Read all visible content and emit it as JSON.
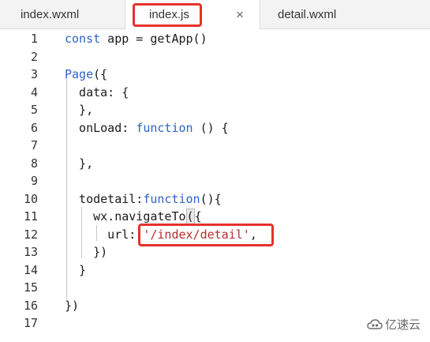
{
  "tabs": [
    {
      "label": "index.wxml"
    },
    {
      "label": "index.js",
      "close": "×"
    },
    {
      "label": "detail.wxml"
    }
  ],
  "lines": [
    {
      "n": "1",
      "code": [
        {
          "t": "kw",
          "v": "const"
        },
        {
          "t": "p",
          "v": " app = getApp()"
        }
      ]
    },
    {
      "n": "2",
      "code": []
    },
    {
      "n": "3",
      "code": [
        {
          "t": "kw",
          "v": "Page"
        },
        {
          "t": "p",
          "v": "({"
        }
      ]
    },
    {
      "n": "4",
      "code": [
        {
          "t": "p",
          "v": "  data: {"
        }
      ]
    },
    {
      "n": "5",
      "code": [
        {
          "t": "p",
          "v": "  },"
        }
      ]
    },
    {
      "n": "6",
      "code": [
        {
          "t": "p",
          "v": "  onLoad: "
        },
        {
          "t": "kw",
          "v": "function"
        },
        {
          "t": "p",
          "v": " () {"
        }
      ]
    },
    {
      "n": "7",
      "code": []
    },
    {
      "n": "8",
      "code": [
        {
          "t": "p",
          "v": "  },"
        }
      ]
    },
    {
      "n": "9",
      "code": []
    },
    {
      "n": "10",
      "code": [
        {
          "t": "p",
          "v": "  todetail:"
        },
        {
          "t": "kw",
          "v": "function"
        },
        {
          "t": "p",
          "v": "(){"
        }
      ]
    },
    {
      "n": "11",
      "code": [
        {
          "t": "p",
          "v": "    wx.navigateTo"
        },
        {
          "t": "brk",
          "v": "("
        },
        {
          "t": "p",
          "v": "{"
        }
      ]
    },
    {
      "n": "12",
      "code": [
        {
          "t": "p",
          "v": "      url: "
        },
        {
          "t": "str",
          "v": "'/index/detail'"
        },
        {
          "t": "p",
          "v": ","
        }
      ]
    },
    {
      "n": "13",
      "code": [
        {
          "t": "p",
          "v": "    })"
        }
      ]
    },
    {
      "n": "14",
      "code": [
        {
          "t": "p",
          "v": "  }"
        }
      ]
    },
    {
      "n": "15",
      "code": []
    },
    {
      "n": "16",
      "code": [
        {
          "t": "p",
          "v": "})"
        }
      ]
    },
    {
      "n": "17",
      "code": []
    }
  ],
  "watermark": {
    "text": "亿速云",
    "icon": "cloud-logo-icon"
  },
  "colors": {
    "keyword": "#2d63c8",
    "string": "#b52e2e",
    "highlight": "#e5322d"
  }
}
